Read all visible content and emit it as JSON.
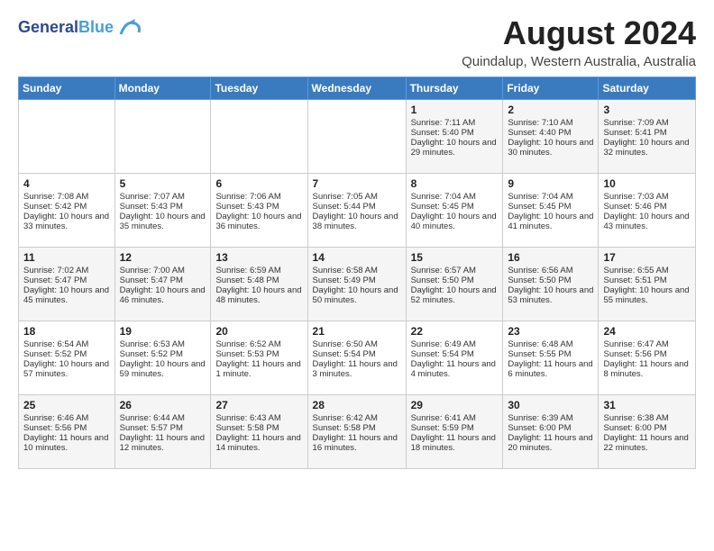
{
  "logo": {
    "line1": "General",
    "line2": "Blue"
  },
  "title": "August 2024",
  "subtitle": "Quindalup, Western Australia, Australia",
  "days_of_week": [
    "Sunday",
    "Monday",
    "Tuesday",
    "Wednesday",
    "Thursday",
    "Friday",
    "Saturday"
  ],
  "weeks": [
    [
      {
        "day": "",
        "sunrise": "",
        "sunset": "",
        "daylight": ""
      },
      {
        "day": "",
        "sunrise": "",
        "sunset": "",
        "daylight": ""
      },
      {
        "day": "",
        "sunrise": "",
        "sunset": "",
        "daylight": ""
      },
      {
        "day": "",
        "sunrise": "",
        "sunset": "",
        "daylight": ""
      },
      {
        "day": "1",
        "sunrise": "Sunrise: 7:11 AM",
        "sunset": "Sunset: 5:40 PM",
        "daylight": "Daylight: 10 hours and 29 minutes."
      },
      {
        "day": "2",
        "sunrise": "Sunrise: 7:10 AM",
        "sunset": "Sunset: 4:40 PM",
        "daylight": "Daylight: 10 hours and 30 minutes."
      },
      {
        "day": "3",
        "sunrise": "Sunrise: 7:09 AM",
        "sunset": "Sunset: 5:41 PM",
        "daylight": "Daylight: 10 hours and 32 minutes."
      }
    ],
    [
      {
        "day": "4",
        "sunrise": "Sunrise: 7:08 AM",
        "sunset": "Sunset: 5:42 PM",
        "daylight": "Daylight: 10 hours and 33 minutes."
      },
      {
        "day": "5",
        "sunrise": "Sunrise: 7:07 AM",
        "sunset": "Sunset: 5:43 PM",
        "daylight": "Daylight: 10 hours and 35 minutes."
      },
      {
        "day": "6",
        "sunrise": "Sunrise: 7:06 AM",
        "sunset": "Sunset: 5:43 PM",
        "daylight": "Daylight: 10 hours and 36 minutes."
      },
      {
        "day": "7",
        "sunrise": "Sunrise: 7:05 AM",
        "sunset": "Sunset: 5:44 PM",
        "daylight": "Daylight: 10 hours and 38 minutes."
      },
      {
        "day": "8",
        "sunrise": "Sunrise: 7:04 AM",
        "sunset": "Sunset: 5:45 PM",
        "daylight": "Daylight: 10 hours and 40 minutes."
      },
      {
        "day": "9",
        "sunrise": "Sunrise: 7:04 AM",
        "sunset": "Sunset: 5:45 PM",
        "daylight": "Daylight: 10 hours and 41 minutes."
      },
      {
        "day": "10",
        "sunrise": "Sunrise: 7:03 AM",
        "sunset": "Sunset: 5:46 PM",
        "daylight": "Daylight: 10 hours and 43 minutes."
      }
    ],
    [
      {
        "day": "11",
        "sunrise": "Sunrise: 7:02 AM",
        "sunset": "Sunset: 5:47 PM",
        "daylight": "Daylight: 10 hours and 45 minutes."
      },
      {
        "day": "12",
        "sunrise": "Sunrise: 7:00 AM",
        "sunset": "Sunset: 5:47 PM",
        "daylight": "Daylight: 10 hours and 46 minutes."
      },
      {
        "day": "13",
        "sunrise": "Sunrise: 6:59 AM",
        "sunset": "Sunset: 5:48 PM",
        "daylight": "Daylight: 10 hours and 48 minutes."
      },
      {
        "day": "14",
        "sunrise": "Sunrise: 6:58 AM",
        "sunset": "Sunset: 5:49 PM",
        "daylight": "Daylight: 10 hours and 50 minutes."
      },
      {
        "day": "15",
        "sunrise": "Sunrise: 6:57 AM",
        "sunset": "Sunset: 5:50 PM",
        "daylight": "Daylight: 10 hours and 52 minutes."
      },
      {
        "day": "16",
        "sunrise": "Sunrise: 6:56 AM",
        "sunset": "Sunset: 5:50 PM",
        "daylight": "Daylight: 10 hours and 53 minutes."
      },
      {
        "day": "17",
        "sunrise": "Sunrise: 6:55 AM",
        "sunset": "Sunset: 5:51 PM",
        "daylight": "Daylight: 10 hours and 55 minutes."
      }
    ],
    [
      {
        "day": "18",
        "sunrise": "Sunrise: 6:54 AM",
        "sunset": "Sunset: 5:52 PM",
        "daylight": "Daylight: 10 hours and 57 minutes."
      },
      {
        "day": "19",
        "sunrise": "Sunrise: 6:53 AM",
        "sunset": "Sunset: 5:52 PM",
        "daylight": "Daylight: 10 hours and 59 minutes."
      },
      {
        "day": "20",
        "sunrise": "Sunrise: 6:52 AM",
        "sunset": "Sunset: 5:53 PM",
        "daylight": "Daylight: 11 hours and 1 minute."
      },
      {
        "day": "21",
        "sunrise": "Sunrise: 6:50 AM",
        "sunset": "Sunset: 5:54 PM",
        "daylight": "Daylight: 11 hours and 3 minutes."
      },
      {
        "day": "22",
        "sunrise": "Sunrise: 6:49 AM",
        "sunset": "Sunset: 5:54 PM",
        "daylight": "Daylight: 11 hours and 4 minutes."
      },
      {
        "day": "23",
        "sunrise": "Sunrise: 6:48 AM",
        "sunset": "Sunset: 5:55 PM",
        "daylight": "Daylight: 11 hours and 6 minutes."
      },
      {
        "day": "24",
        "sunrise": "Sunrise: 6:47 AM",
        "sunset": "Sunset: 5:56 PM",
        "daylight": "Daylight: 11 hours and 8 minutes."
      }
    ],
    [
      {
        "day": "25",
        "sunrise": "Sunrise: 6:46 AM",
        "sunset": "Sunset: 5:56 PM",
        "daylight": "Daylight: 11 hours and 10 minutes."
      },
      {
        "day": "26",
        "sunrise": "Sunrise: 6:44 AM",
        "sunset": "Sunset: 5:57 PM",
        "daylight": "Daylight: 11 hours and 12 minutes."
      },
      {
        "day": "27",
        "sunrise": "Sunrise: 6:43 AM",
        "sunset": "Sunset: 5:58 PM",
        "daylight": "Daylight: 11 hours and 14 minutes."
      },
      {
        "day": "28",
        "sunrise": "Sunrise: 6:42 AM",
        "sunset": "Sunset: 5:58 PM",
        "daylight": "Daylight: 11 hours and 16 minutes."
      },
      {
        "day": "29",
        "sunrise": "Sunrise: 6:41 AM",
        "sunset": "Sunset: 5:59 PM",
        "daylight": "Daylight: 11 hours and 18 minutes."
      },
      {
        "day": "30",
        "sunrise": "Sunrise: 6:39 AM",
        "sunset": "Sunset: 6:00 PM",
        "daylight": "Daylight: 11 hours and 20 minutes."
      },
      {
        "day": "31",
        "sunrise": "Sunrise: 6:38 AM",
        "sunset": "Sunset: 6:00 PM",
        "daylight": "Daylight: 11 hours and 22 minutes."
      }
    ]
  ]
}
